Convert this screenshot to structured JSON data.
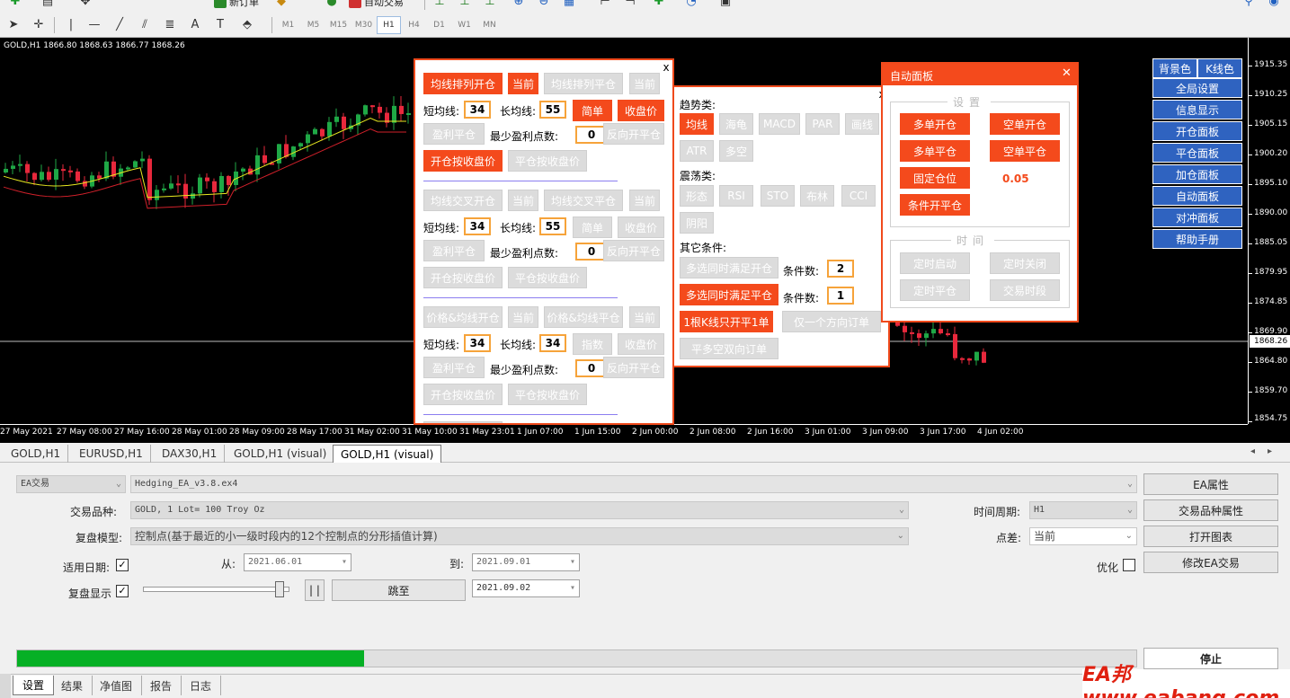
{
  "toolbar": {
    "new_order_label": "新订单",
    "auto_trade_label": "自动交易",
    "timeframes": [
      "M1",
      "M5",
      "M15",
      "M30",
      "H1",
      "H4",
      "D1",
      "W1",
      "MN"
    ],
    "active_timeframe": "H1"
  },
  "chart": {
    "title": "GOLD,H1  1866.80 1868.63 1866.77 1868.26",
    "price_labels": [
      "1915.35",
      "1910.25",
      "1905.15",
      "1900.20",
      "1895.10",
      "1890.00",
      "1885.05",
      "1879.95",
      "1874.85",
      "1869.90",
      "1864.80",
      "1859.70",
      "1854.75"
    ],
    "current_price": "1868.26",
    "time_labels": [
      "27 May 2021",
      "27 May 08:00",
      "27 May 16:00",
      "28 May 01:00",
      "28 May 09:00",
      "28 May 17:00",
      "31 May 02:00",
      "31 May 10:00",
      "31 May 23:01",
      "1 Jun 07:00",
      "1 Jun 15:00",
      "2 Jun 00:00",
      "2 Jun 08:00",
      "2 Jun 16:00",
      "3 Jun 01:00",
      "3 Jun 09:00",
      "3 Jun 17:00",
      "4 Jun 02:00"
    ],
    "colors": {
      "bull": "#1fa846",
      "bear": "#e8283c",
      "ma_fast": "#e8e820",
      "ma_slow": "#d0202a"
    }
  },
  "panel1": {
    "close": "x",
    "g1": {
      "open": "均线排列开仓",
      "cur1": "当前",
      "close": "均线排列平仓",
      "cur2": "当前",
      "short": "短均线:",
      "short_v": "34",
      "long": "长均线:",
      "long_v": "55",
      "mode": "简单",
      "price": "收盘价",
      "tp": "盈利平仓",
      "minpts": "最少盈利点数:",
      "minpts_v": "0",
      "rev": "反向开平仓",
      "openclose": "开仓按收盘价",
      "closeclose": "平仓按收盘价"
    },
    "g2": {
      "open": "均线交叉开仓",
      "cur1": "当前",
      "close": "均线交叉平仓",
      "cur2": "当前",
      "short": "短均线:",
      "short_v": "34",
      "long": "长均线:",
      "long_v": "55",
      "mode": "简单",
      "price": "收盘价",
      "tp": "盈利平仓",
      "minpts": "最少盈利点数:",
      "minpts_v": "0",
      "rev": "反向开平仓",
      "openclose": "开仓按收盘价",
      "closeclose": "平仓按收盘价"
    },
    "g3": {
      "open": "价格&均线开仓",
      "cur1": "当前",
      "close": "价格&均线平仓",
      "cur2": "当前",
      "short": "短均线:",
      "short_v": "34",
      "long": "长均线:",
      "long_v": "34",
      "mode": "指数",
      "price": "收盘价",
      "tp": "盈利平仓",
      "minpts": "最少盈利点数:",
      "minpts_v": "0",
      "rev": "反向开平仓",
      "openclose": "开仓按收盘价",
      "closeclose": "平仓按收盘价"
    }
  },
  "panel2": {
    "close": "x",
    "trend_title": "趋势类:",
    "trend": [
      "均线",
      "海龟",
      "MACD",
      "PAR",
      "画线",
      "ATR",
      "多空"
    ],
    "osc_title": "震荡类:",
    "osc": [
      "形态",
      "RSI",
      "STO",
      "布林",
      "CCI",
      "阴阳"
    ],
    "other_title": "其它条件:",
    "multi1": "多选同时满足开仓",
    "cond_count": "条件数:",
    "cond1_v": "2",
    "multi2": "多选同时满足平仓",
    "cond2_v": "1",
    "one_bar": "1根K线只开平1单",
    "one_dir": "仅一个方向订单",
    "hedge": "平多空双向订单"
  },
  "panel3": {
    "title": "自动面板",
    "close": "✕",
    "settings": "设置",
    "buy_open": "多单开仓",
    "sell_open": "空单开仓",
    "buy_close": "多单平仓",
    "sell_close": "空单平仓",
    "fixed_lot": "固定仓位",
    "lot_value": "0.05",
    "cond_open": "条件开平仓",
    "time": "时间",
    "timer_start": "定时启动",
    "timer_close": "定时关闭",
    "timer_flat": "定时平仓",
    "session": "交易时段"
  },
  "right_menu": {
    "bg_color": "背景色",
    "k_color": "K线色",
    "items": [
      "全局设置",
      "信息显示",
      "开仓面板",
      "平仓面板",
      "加仓面板",
      "自动面板",
      "对冲面板",
      "帮助手册"
    ]
  },
  "chart_tabs": [
    "GOLD,H1",
    "EURUSD,H1",
    "DAX30,H1",
    "GOLD,H1 (visual)",
    "GOLD,H1 (visual)"
  ],
  "chart_tabs_active": 4,
  "tester": {
    "mode": "EA交易",
    "ea_file": "Hedging_EA_v3.8.ex4",
    "ea_props": "EA属性",
    "symbol_label": "交易品种:",
    "symbol": "GOLD, 1 Lot= 100 Troy Oz",
    "symbol_props": "交易品种属性",
    "period_label": "时间周期:",
    "period": "H1",
    "model_label": "复盘模型:",
    "model": "控制点(基于最近的小一级时段内的12个控制点的分形插值计算)",
    "spread_label": "点差:",
    "spread": "当前",
    "open_chart": "打开图表",
    "use_date": "适用日期:",
    "from": "从:",
    "from_date": "2021.06.01",
    "to": "到:",
    "to_date": "2021.09.01",
    "optimize": "优化",
    "modify_ea": "修改EA交易",
    "visual": "复盘显示",
    "pause": "| |",
    "jump": "跳至",
    "jump_date": "2021.09.02",
    "progress": 0.31,
    "stop": "停止"
  },
  "bottom_tabs": [
    "设置",
    "结果",
    "净值图",
    "报告",
    "日志"
  ],
  "bottom_tabs_active": 0,
  "watermark": "EA邦www.eabang.com"
}
